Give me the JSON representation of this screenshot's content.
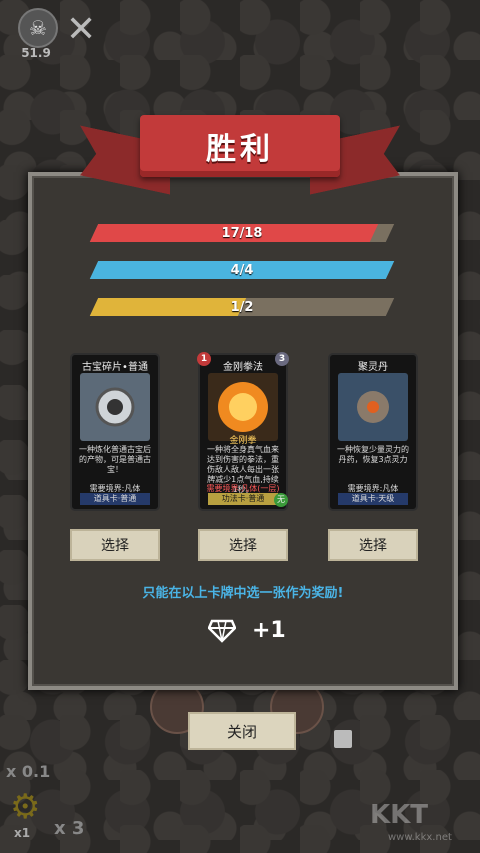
{
  "hud": {
    "speed_top": "51.9"
  },
  "banner": {
    "title": "胜利"
  },
  "bars": [
    {
      "label": "17/18",
      "value": 17,
      "max": 18,
      "color": "#e04848"
    },
    {
      "label": "4/4",
      "value": 4,
      "max": 4,
      "color": "#4ab4e0"
    },
    {
      "label": "1/2",
      "value": 1,
      "max": 2,
      "color": "#e0b43a"
    }
  ],
  "cards": [
    {
      "name": "古宝碎片•普通",
      "desc": "一种炼化普通古宝后的产物，可是普通古宝！",
      "req": "需要境界:凡体",
      "type": "道具卡·普通"
    },
    {
      "name": "金刚拳法",
      "cost_left": "1",
      "cost_right": "3",
      "art_text": "金刚拳",
      "desc": "一种将全身真气血来达到伤害的拳法，重伤敌人敌人每出一张牌减少1点气血,持续1秒。",
      "req": "需要境界:凡体(一层)",
      "type": "功法卡·普通",
      "corner": "无"
    },
    {
      "name": "聚灵丹",
      "desc": "一种恢复少量灵力的丹药，恢复3点灵力",
      "req": "需要境界:凡体",
      "type": "道具卡·天级"
    }
  ],
  "select_label": "选择",
  "hint": "只能在以上卡牌中选一张作为奖励!",
  "reward": {
    "icon": "diamond-icon",
    "amount": "+1"
  },
  "close_label": "关闭",
  "speed_label": "x 0.1",
  "gear_mult": "x1",
  "x3_label": "x 3",
  "watermark": {
    "logo": "KKT",
    "url": "www.kkx.net"
  }
}
